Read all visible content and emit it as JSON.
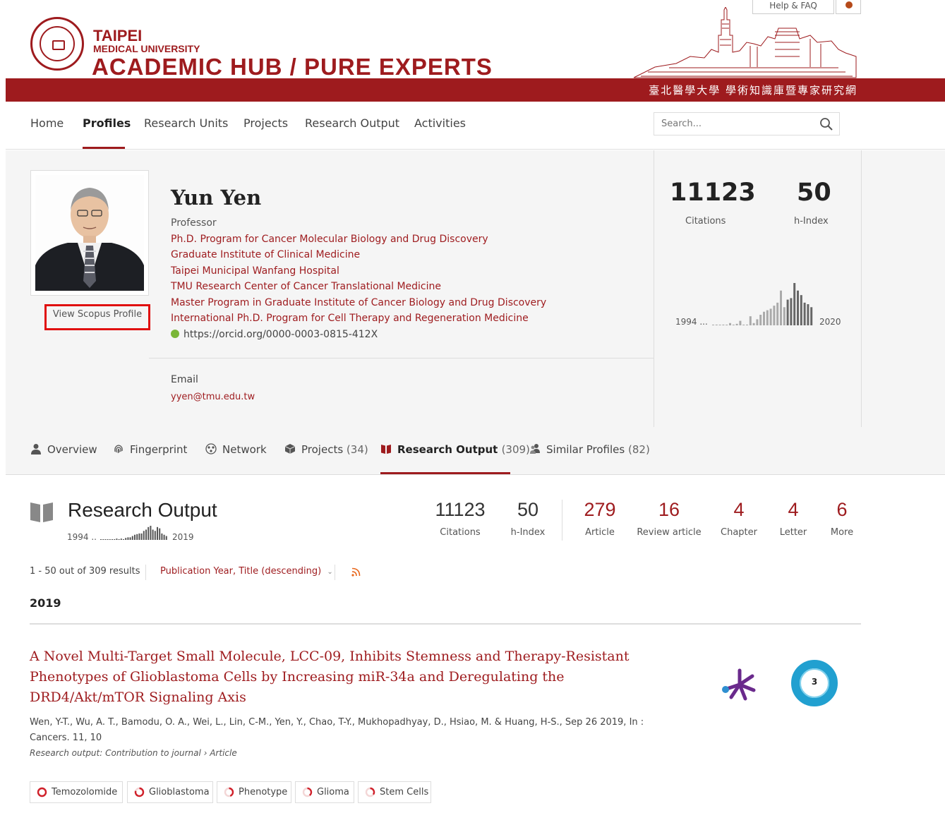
{
  "header": {
    "line1": "TAIPEI",
    "line2": "MEDICAL UNIVERSITY",
    "line3": "ACADEMIC  HUB / PURE  EXPERTS",
    "chinese": "臺北醫學大學 學術知識庫暨專家研究網",
    "help": "Help & FAQ",
    "brand_color": "#9e1b1e"
  },
  "nav": {
    "items": [
      "Home",
      "Profiles",
      "Research Units",
      "Projects",
      "Research Output",
      "Activities"
    ],
    "active": "Profiles",
    "search_placeholder": "Search..."
  },
  "profile": {
    "name": "Yun Yen",
    "title": "Professor",
    "affiliations": [
      "Ph.D. Program for Cancer Molecular Biology and Drug Discovery",
      "Graduate Institute of Clinical Medicine",
      "Taipei Municipal Wanfang Hospital",
      "TMU Research Center of Cancer Translational Medicine",
      "Master Program in Graduate Institute of Cancer Biology and Drug Discovery",
      "International Ph.D. Program for Cell Therapy and Regeneration Medicine"
    ],
    "orcid": "https://orcid.org/0000-0003-0815-412X",
    "scopus_link": "View Scopus Profile",
    "email_label": "Email",
    "email": "yyen@tmu.edu.tw",
    "metrics": {
      "citations": "11123",
      "citations_label": "Citations",
      "hindex": "50",
      "hindex_label": "h-Index",
      "spark_start": "1994 ...",
      "spark_end": "2020"
    }
  },
  "tabs": [
    {
      "label": "Overview",
      "count": ""
    },
    {
      "label": "Fingerprint",
      "count": ""
    },
    {
      "label": "Network",
      "count": ""
    },
    {
      "label": "Projects",
      "count": "(34)"
    },
    {
      "label": "Research Output",
      "count": "(309)"
    },
    {
      "label": "Similar Profiles",
      "count": "(82)"
    }
  ],
  "research_output": {
    "title": "Research Output",
    "spark_start": "1994 ..",
    "spark_end": "2019",
    "stats": [
      {
        "value": "11123",
        "label": "Citations"
      },
      {
        "value": "50",
        "label": "h-Index"
      },
      {
        "value": "279",
        "label": "Article"
      },
      {
        "value": "16",
        "label": "Review article"
      },
      {
        "value": "4",
        "label": "Chapter"
      },
      {
        "value": "4",
        "label": "Letter"
      },
      {
        "value": "6",
        "label": "More"
      }
    ],
    "results_text": "1 - 50 out of 309 results",
    "sort_label": "Publication Year, Title (descending)",
    "year": "2019"
  },
  "publication": {
    "title": "A Novel Multi-Target Small Molecule, LCC-09, Inhibits Stemness and Therapy-Resistant Phenotypes of Glioblastoma Cells by Increasing miR-34a and Deregulating the DRD4/Akt/mTOR Signaling Axis",
    "authors": "Wen, Y-T., Wu, A. T., Bamodu, O. A., Wei, L., Lin, C-M., Yen, Y., Chao, T-Y., Mukhopadhyay, D., Hsiao, M. & Huang, H-S., Sep 26 2019, In : Cancers. 11, 10",
    "type": "Research output: Contribution to journal › Article",
    "citations": "3",
    "tags": [
      "Temozolomide",
      "Glioblastoma",
      "Phenotype",
      "Glioma",
      "Stem Cells"
    ],
    "tag_fill": [
      1.0,
      0.8,
      0.45,
      0.4,
      0.35
    ]
  }
}
